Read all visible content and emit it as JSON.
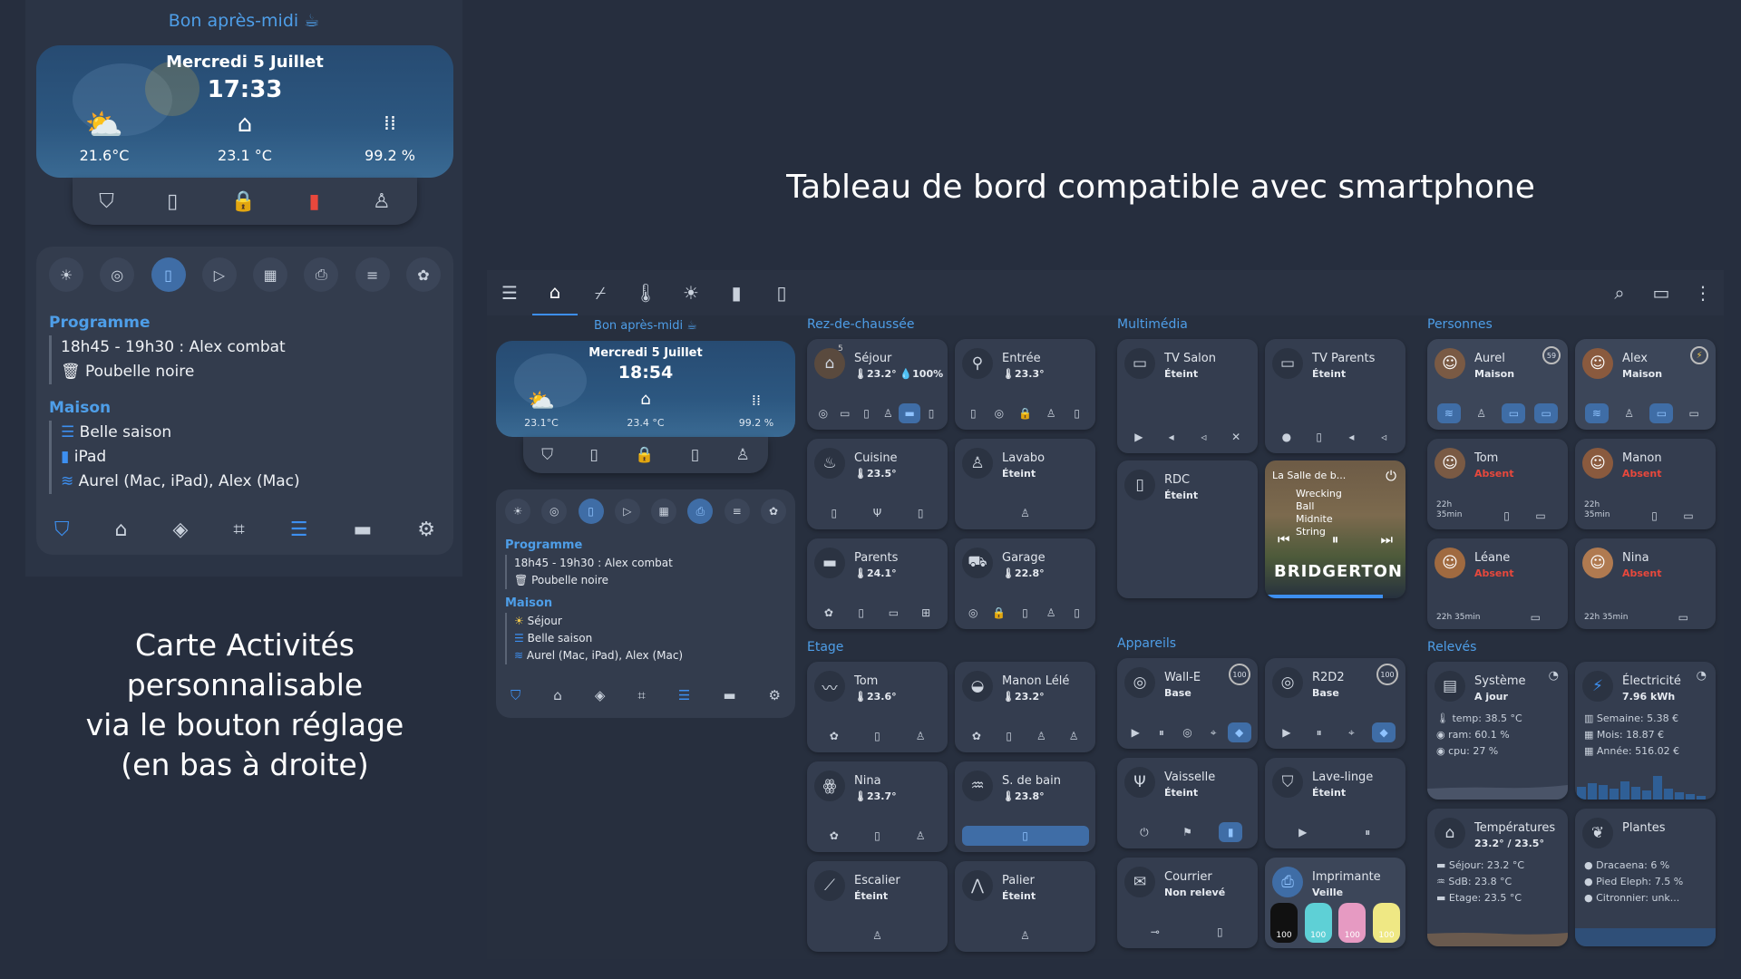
{
  "big": {
    "greeting": "Bon après-midi ☕",
    "date": "Mercredi 5 Juillet",
    "time": "17:33",
    "outside_temp": "21.6°C",
    "inside_temp": "23.1 °C",
    "humidity": "99.2 %",
    "programme_title": "Programme",
    "programme_lines": [
      "18h45 - 19h30 : Alex combat",
      "Poubelle noire"
    ],
    "maison_title": "Maison",
    "maison_lines": [
      "Belle saison",
      "iPad",
      "Aurel (Mac, iPad), Alex (Mac)"
    ]
  },
  "headline": "Tableau de bord compatible avec smartphone",
  "caption": [
    "Carte Activités",
    "personnalisable",
    "via le bouton réglage",
    "(en bas à droite)"
  ],
  "small": {
    "greeting": "Bon après-midi ☕",
    "date": "Mercredi 5 Juillet",
    "time": "18:54",
    "outside_temp": "23.1°C",
    "inside_temp": "23.4 °C",
    "humidity": "99.2 %",
    "programme_title": "Programme",
    "programme_lines": [
      "18h45 - 19h30 : Alex combat",
      "Poubelle noire"
    ],
    "maison_title": "Maison",
    "maison_lines": [
      "Séjour",
      "Belle saison",
      "Aurel (Mac, iPad), Alex (Mac)"
    ]
  },
  "columns": {
    "rdc": "Rez-de-chaussée",
    "etage": "Etage",
    "multimedia": "Multimédia",
    "appareils": "Appareils",
    "personnes": "Personnes",
    "releves": "Relevés"
  },
  "rooms": {
    "sejour": {
      "name": "Séjour",
      "sub": "🌡23.2° 💧100%",
      "badge": "5"
    },
    "entree": {
      "name": "Entrée",
      "sub": "🌡23.3°"
    },
    "cuisine": {
      "name": "Cuisine",
      "sub": "🌡23.5°"
    },
    "lavabo": {
      "name": "Lavabo",
      "sub": "Éteint"
    },
    "parents": {
      "name": "Parents",
      "sub": "🌡24.1°"
    },
    "garage": {
      "name": "Garage",
      "sub": "🌡22.8°"
    },
    "tom": {
      "name": "Tom",
      "sub": "🌡23.6°"
    },
    "manon": {
      "name": "Manon Lélé",
      "sub": "🌡23.2°"
    },
    "nina": {
      "name": "Nina",
      "sub": "🌡23.7°"
    },
    "sdb": {
      "name": "S. de bain",
      "sub": "🌡23.8°"
    },
    "escalier": {
      "name": "Escalier",
      "sub": "Éteint"
    },
    "palier": {
      "name": "Palier",
      "sub": "Éteint"
    }
  },
  "media": {
    "tvsalon": {
      "name": "TV Salon",
      "sub": "Éteint"
    },
    "tvparents": {
      "name": "TV Parents",
      "sub": "Éteint"
    },
    "rdc": {
      "name": "RDC",
      "sub": "Éteint"
    },
    "player_title": "La Salle de b...",
    "player_lines": [
      "Wrecking",
      "Ball",
      "Midnite",
      "String"
    ],
    "player_show": "BRIDGERTON"
  },
  "devices": {
    "walle": {
      "name": "Wall-E",
      "sub": "Base",
      "level": "100"
    },
    "r2d2": {
      "name": "R2D2",
      "sub": "Base",
      "level": "100"
    },
    "vaisselle": {
      "name": "Vaisselle",
      "sub": "Éteint"
    },
    "lavelinge": {
      "name": "Lave-linge",
      "sub": "Éteint"
    },
    "courrier": {
      "name": "Courrier",
      "sub": "Non relevé"
    },
    "imprimante": {
      "name": "Imprimante",
      "sub": "Veille",
      "inks": [
        "100",
        "100",
        "100",
        "100"
      ]
    }
  },
  "people": {
    "aurel": {
      "name": "Aurel",
      "sub": "Maison",
      "badge": "59"
    },
    "alex": {
      "name": "Alex",
      "sub": "Maison"
    },
    "tom": {
      "name": "Tom",
      "sub": "Absent",
      "time": "22h 35min"
    },
    "manon": {
      "name": "Manon",
      "sub": "Absent",
      "time": "22h 35min"
    },
    "leane": {
      "name": "Léane",
      "sub": "Absent",
      "time": "22h 35min"
    },
    "nina": {
      "name": "Nina",
      "sub": "Absent",
      "time": "22h 35min"
    }
  },
  "readings": {
    "systeme": {
      "name": "Système",
      "sub": "A jour",
      "lines": [
        "temp: 38.5 °C",
        "ram: 60.1 %",
        "cpu: 27 %"
      ]
    },
    "electricite": {
      "name": "Électricité",
      "sub": "7.96 kWh",
      "lines": [
        "Semaine: 5.38 €",
        "Mois: 18.87 €",
        "Année: 516.02 €"
      ]
    },
    "temperatures": {
      "name": "Températures",
      "sub": "23.2° / 23.5°",
      "lines": [
        "Séjour: 23.2 °C",
        "SdB: 23.8 °C",
        "Etage: 23.5 °C"
      ]
    },
    "plantes": {
      "name": "Plantes",
      "lines": [
        "Dracaena: 6 %",
        "Pied Eleph: 7.5 %",
        "Citronnier: unk..."
      ]
    }
  },
  "colors": {
    "accent": "#3d8ff0",
    "absent": "#e8483c",
    "bg": "#262e3e",
    "card": "#343d4f"
  }
}
